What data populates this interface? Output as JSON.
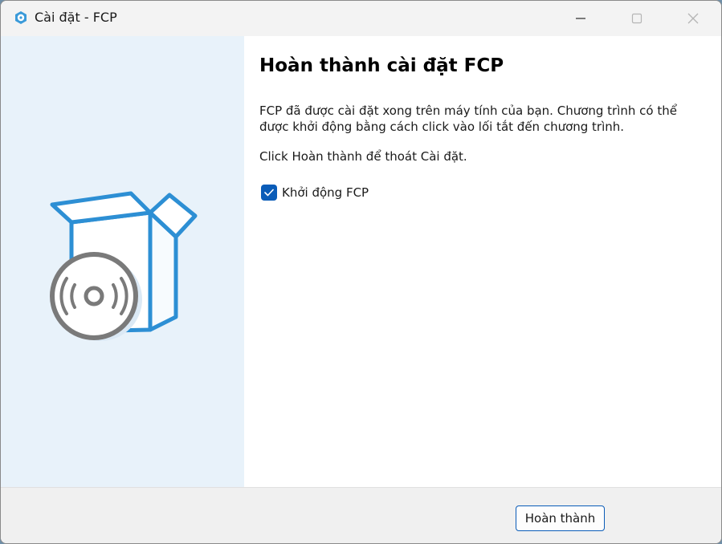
{
  "window": {
    "title": "Cài đặt - FCP"
  },
  "page": {
    "heading": "Hoàn thành cài đặt FCP",
    "description": "FCP đã được cài đặt xong trên máy tính của bạn. Chương trình có thể được khởi động bằng cách click vào lối tắt đến chương trình.",
    "hint": "Click Hoàn thành để thoát Cài đặt."
  },
  "options": {
    "launch_label": "Khởi động FCP",
    "launch_checked": true
  },
  "footer": {
    "finish_label": "Hoàn thành"
  },
  "colors": {
    "accent": "#0a5cb8",
    "side_panel": "#e8f2fa",
    "box_outline": "#2d8fd4",
    "disc": "#7a7a7a"
  },
  "icons": {
    "app": "setup-app-icon",
    "minimize": "minimize-icon",
    "maximize": "maximize-icon",
    "close": "close-icon",
    "illustration": "software-box-disc-icon",
    "check": "checkmark-icon"
  }
}
